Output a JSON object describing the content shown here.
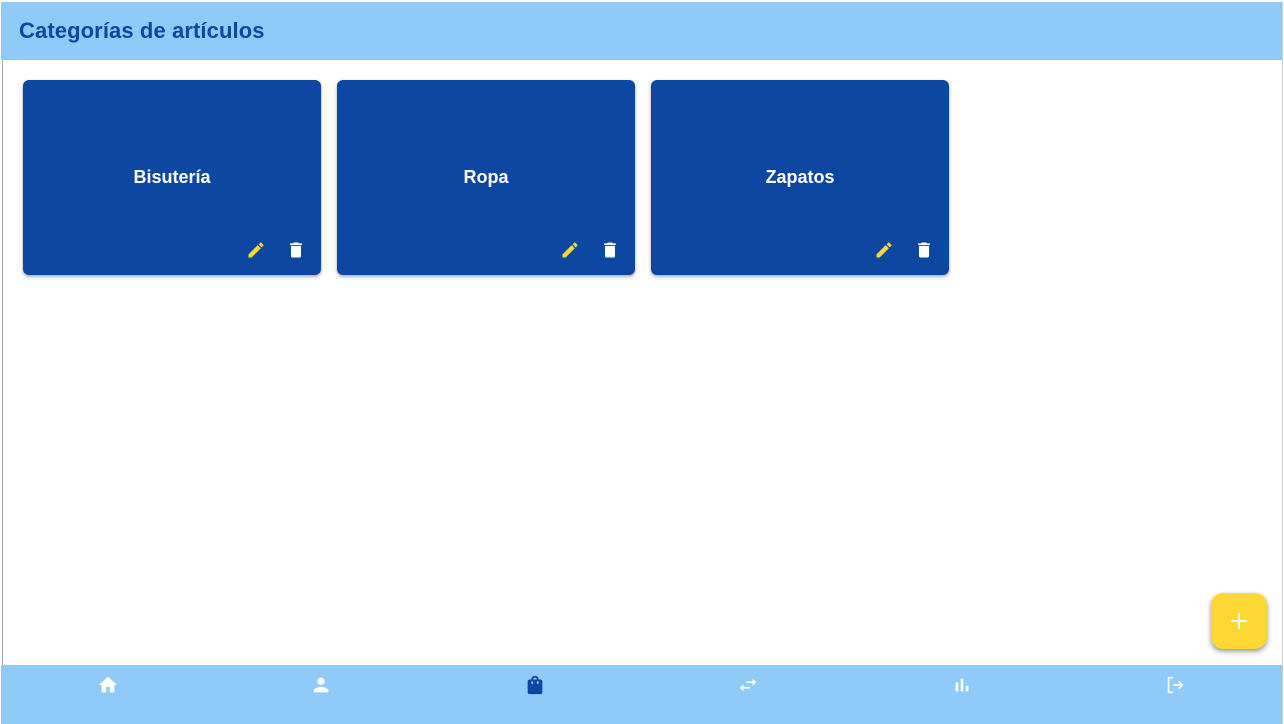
{
  "header": {
    "title": "Categorías de artículos"
  },
  "categories": [
    {
      "label": "Bisutería"
    },
    {
      "label": "Ropa"
    },
    {
      "label": "Zapatos"
    }
  ],
  "card_actions": {
    "edit_icon": "pencil-icon",
    "delete_icon": "trash-icon"
  },
  "fab": {
    "icon": "plus-icon"
  },
  "bottom_nav": {
    "items": [
      {
        "icon": "home-icon",
        "active": false
      },
      {
        "icon": "person-icon",
        "active": false
      },
      {
        "icon": "shopping-bag-icon",
        "active": true
      },
      {
        "icon": "swap-arrows-icon",
        "active": false
      },
      {
        "icon": "bar-chart-icon",
        "active": false
      },
      {
        "icon": "logout-icon",
        "active": false
      }
    ]
  },
  "colors": {
    "app_bar": "#90caf9",
    "title_text": "#0d47a1",
    "card": "#0d47a1",
    "edit_icon": "#fdd835",
    "delete_icon": "#ffffff",
    "fab": "#fdd835",
    "nav_icon": "#ffffff",
    "nav_icon_active": "#0d47a1"
  }
}
